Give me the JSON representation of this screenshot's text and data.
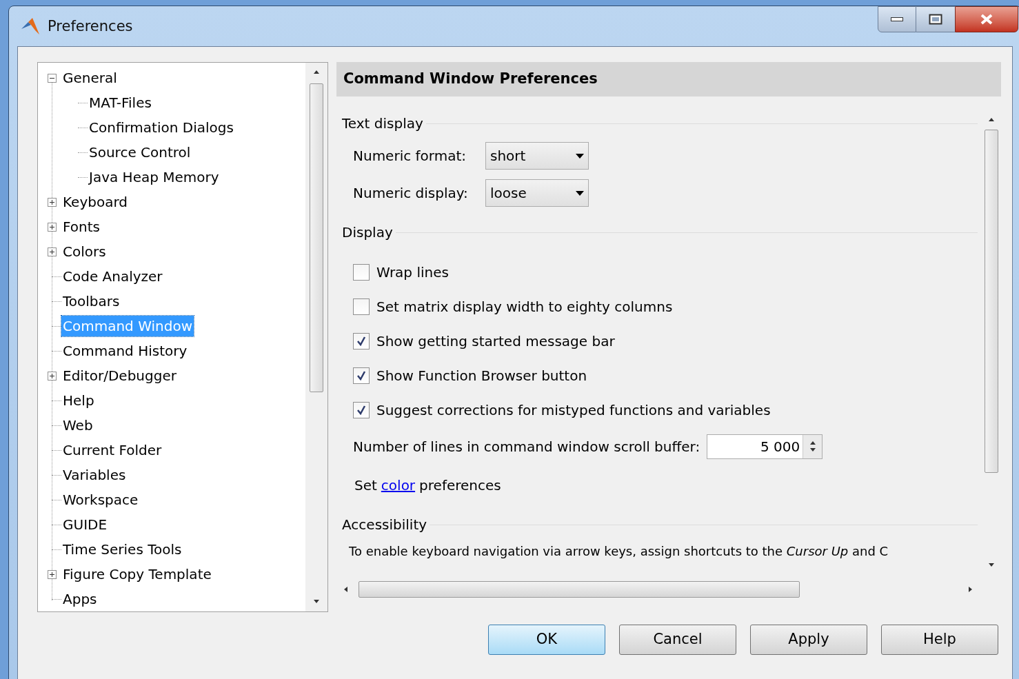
{
  "window": {
    "title": "Preferences"
  },
  "tree": [
    {
      "label": "General",
      "selected": false,
      "expanded": true,
      "children": [
        {
          "label": "MAT-Files",
          "selected": false
        },
        {
          "label": "Confirmation Dialogs",
          "selected": false
        },
        {
          "label": "Source Control",
          "selected": false
        },
        {
          "label": "Java Heap Memory",
          "selected": false
        }
      ]
    },
    {
      "label": "Keyboard",
      "selected": false,
      "expanded": false
    },
    {
      "label": "Fonts",
      "selected": false,
      "expanded": false
    },
    {
      "label": "Colors",
      "selected": false,
      "expanded": false
    },
    {
      "label": "Code Analyzer",
      "selected": false
    },
    {
      "label": "Toolbars",
      "selected": false
    },
    {
      "label": "Command Window",
      "selected": true
    },
    {
      "label": "Command History",
      "selected": false
    },
    {
      "label": "Editor/Debugger",
      "selected": false,
      "expanded": false
    },
    {
      "label": "Help",
      "selected": false
    },
    {
      "label": "Web",
      "selected": false
    },
    {
      "label": "Current Folder",
      "selected": false
    },
    {
      "label": "Variables",
      "selected": false
    },
    {
      "label": "Workspace",
      "selected": false
    },
    {
      "label": "GUIDE",
      "selected": false
    },
    {
      "label": "Time Series Tools",
      "selected": false
    },
    {
      "label": "Figure Copy Template",
      "selected": false,
      "expanded": false
    },
    {
      "label": "Apps",
      "selected": false
    }
  ],
  "panel_title": "Command Window Preferences",
  "text_display": {
    "title": "Text display",
    "dropdowns": [
      {
        "label": "Numeric format:",
        "value": "short"
      },
      {
        "label": "Numeric display:",
        "value": "loose"
      }
    ]
  },
  "display": {
    "title": "Display",
    "checkboxes": [
      {
        "label": "Wrap lines",
        "checked": false
      },
      {
        "label": "Set matrix display width to eighty columns",
        "checked": false
      },
      {
        "label": "Show getting started message bar",
        "checked": true
      },
      {
        "label": "Show Function Browser button",
        "checked": true
      },
      {
        "label": "Suggest corrections for mistyped functions and variables",
        "checked": true
      }
    ],
    "scroll_buffer": {
      "label": "Number of lines in command window scroll buffer:",
      "value": "5 000"
    },
    "color_link": {
      "before": "Set",
      "link": "color",
      "after": "preferences"
    }
  },
  "accessibility": {
    "title": "Accessibility",
    "text": "To enable keyboard navigation via arrow keys, assign shortcuts to the *Cursor Up* and C"
  },
  "buttons": [
    {
      "label": "OK",
      "default": true
    },
    {
      "label": "Cancel",
      "default": false
    },
    {
      "label": "Apply",
      "default": false
    },
    {
      "label": "Help",
      "default": false
    }
  ]
}
